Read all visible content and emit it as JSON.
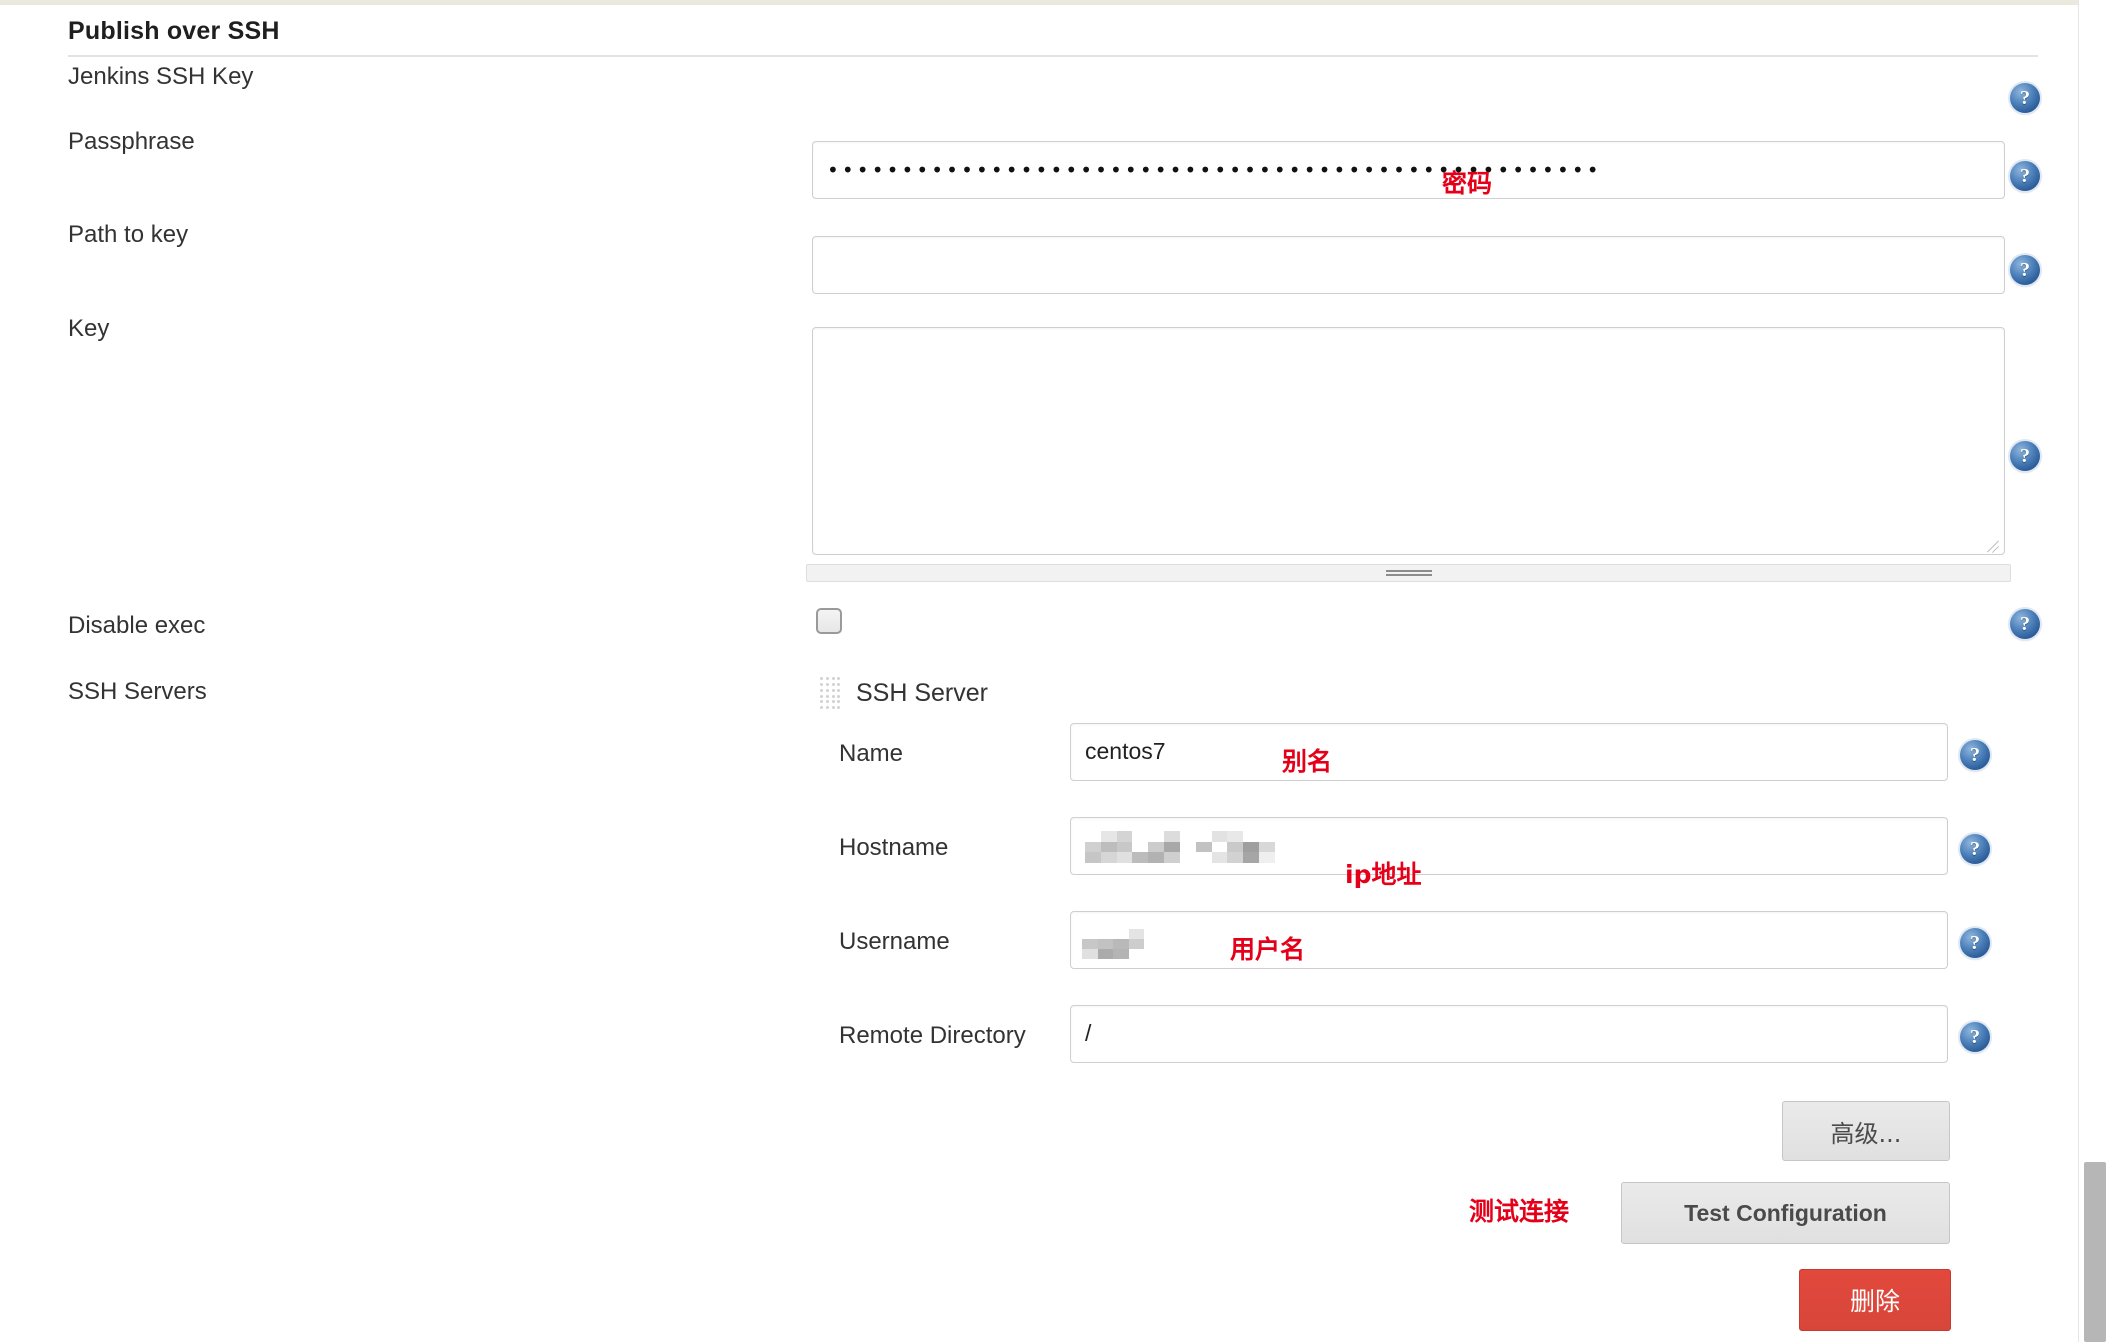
{
  "section": {
    "title": "Publish over SSH"
  },
  "fields": {
    "jenkins_ssh_key": {
      "label": "Jenkins SSH Key"
    },
    "passphrase": {
      "label": "Passphrase",
      "value": "••••••••••••••••••••••••••••••••••••••••••••••••••••",
      "note": "密码"
    },
    "path_to_key": {
      "label": "Path to key",
      "value": ""
    },
    "key": {
      "label": "Key",
      "value": ""
    },
    "disable_exec": {
      "label": "Disable exec",
      "checked": false
    },
    "ssh_servers": {
      "label": "SSH Servers"
    }
  },
  "ssh_server": {
    "title": "SSH Server",
    "name": {
      "label": "Name",
      "value": "centos7",
      "note": "别名"
    },
    "hostname": {
      "label": "Hostname",
      "value": "",
      "note": "ip地址",
      "redacted": true
    },
    "username": {
      "label": "Username",
      "value": "",
      "note": "用户名",
      "redacted": true
    },
    "remote_directory": {
      "label": "Remote Directory",
      "value": "/"
    }
  },
  "buttons": {
    "advanced": "高级...",
    "test_configuration": "Test Configuration",
    "test_configuration_note": "测试连接",
    "delete": "删除"
  },
  "icons": {
    "help": "?"
  },
  "colors": {
    "annotation_red": "#e50019",
    "delete_button": "#d8463a",
    "help_icon_blue": "#2e5f9c",
    "top_rule": "#ebe9dd"
  }
}
